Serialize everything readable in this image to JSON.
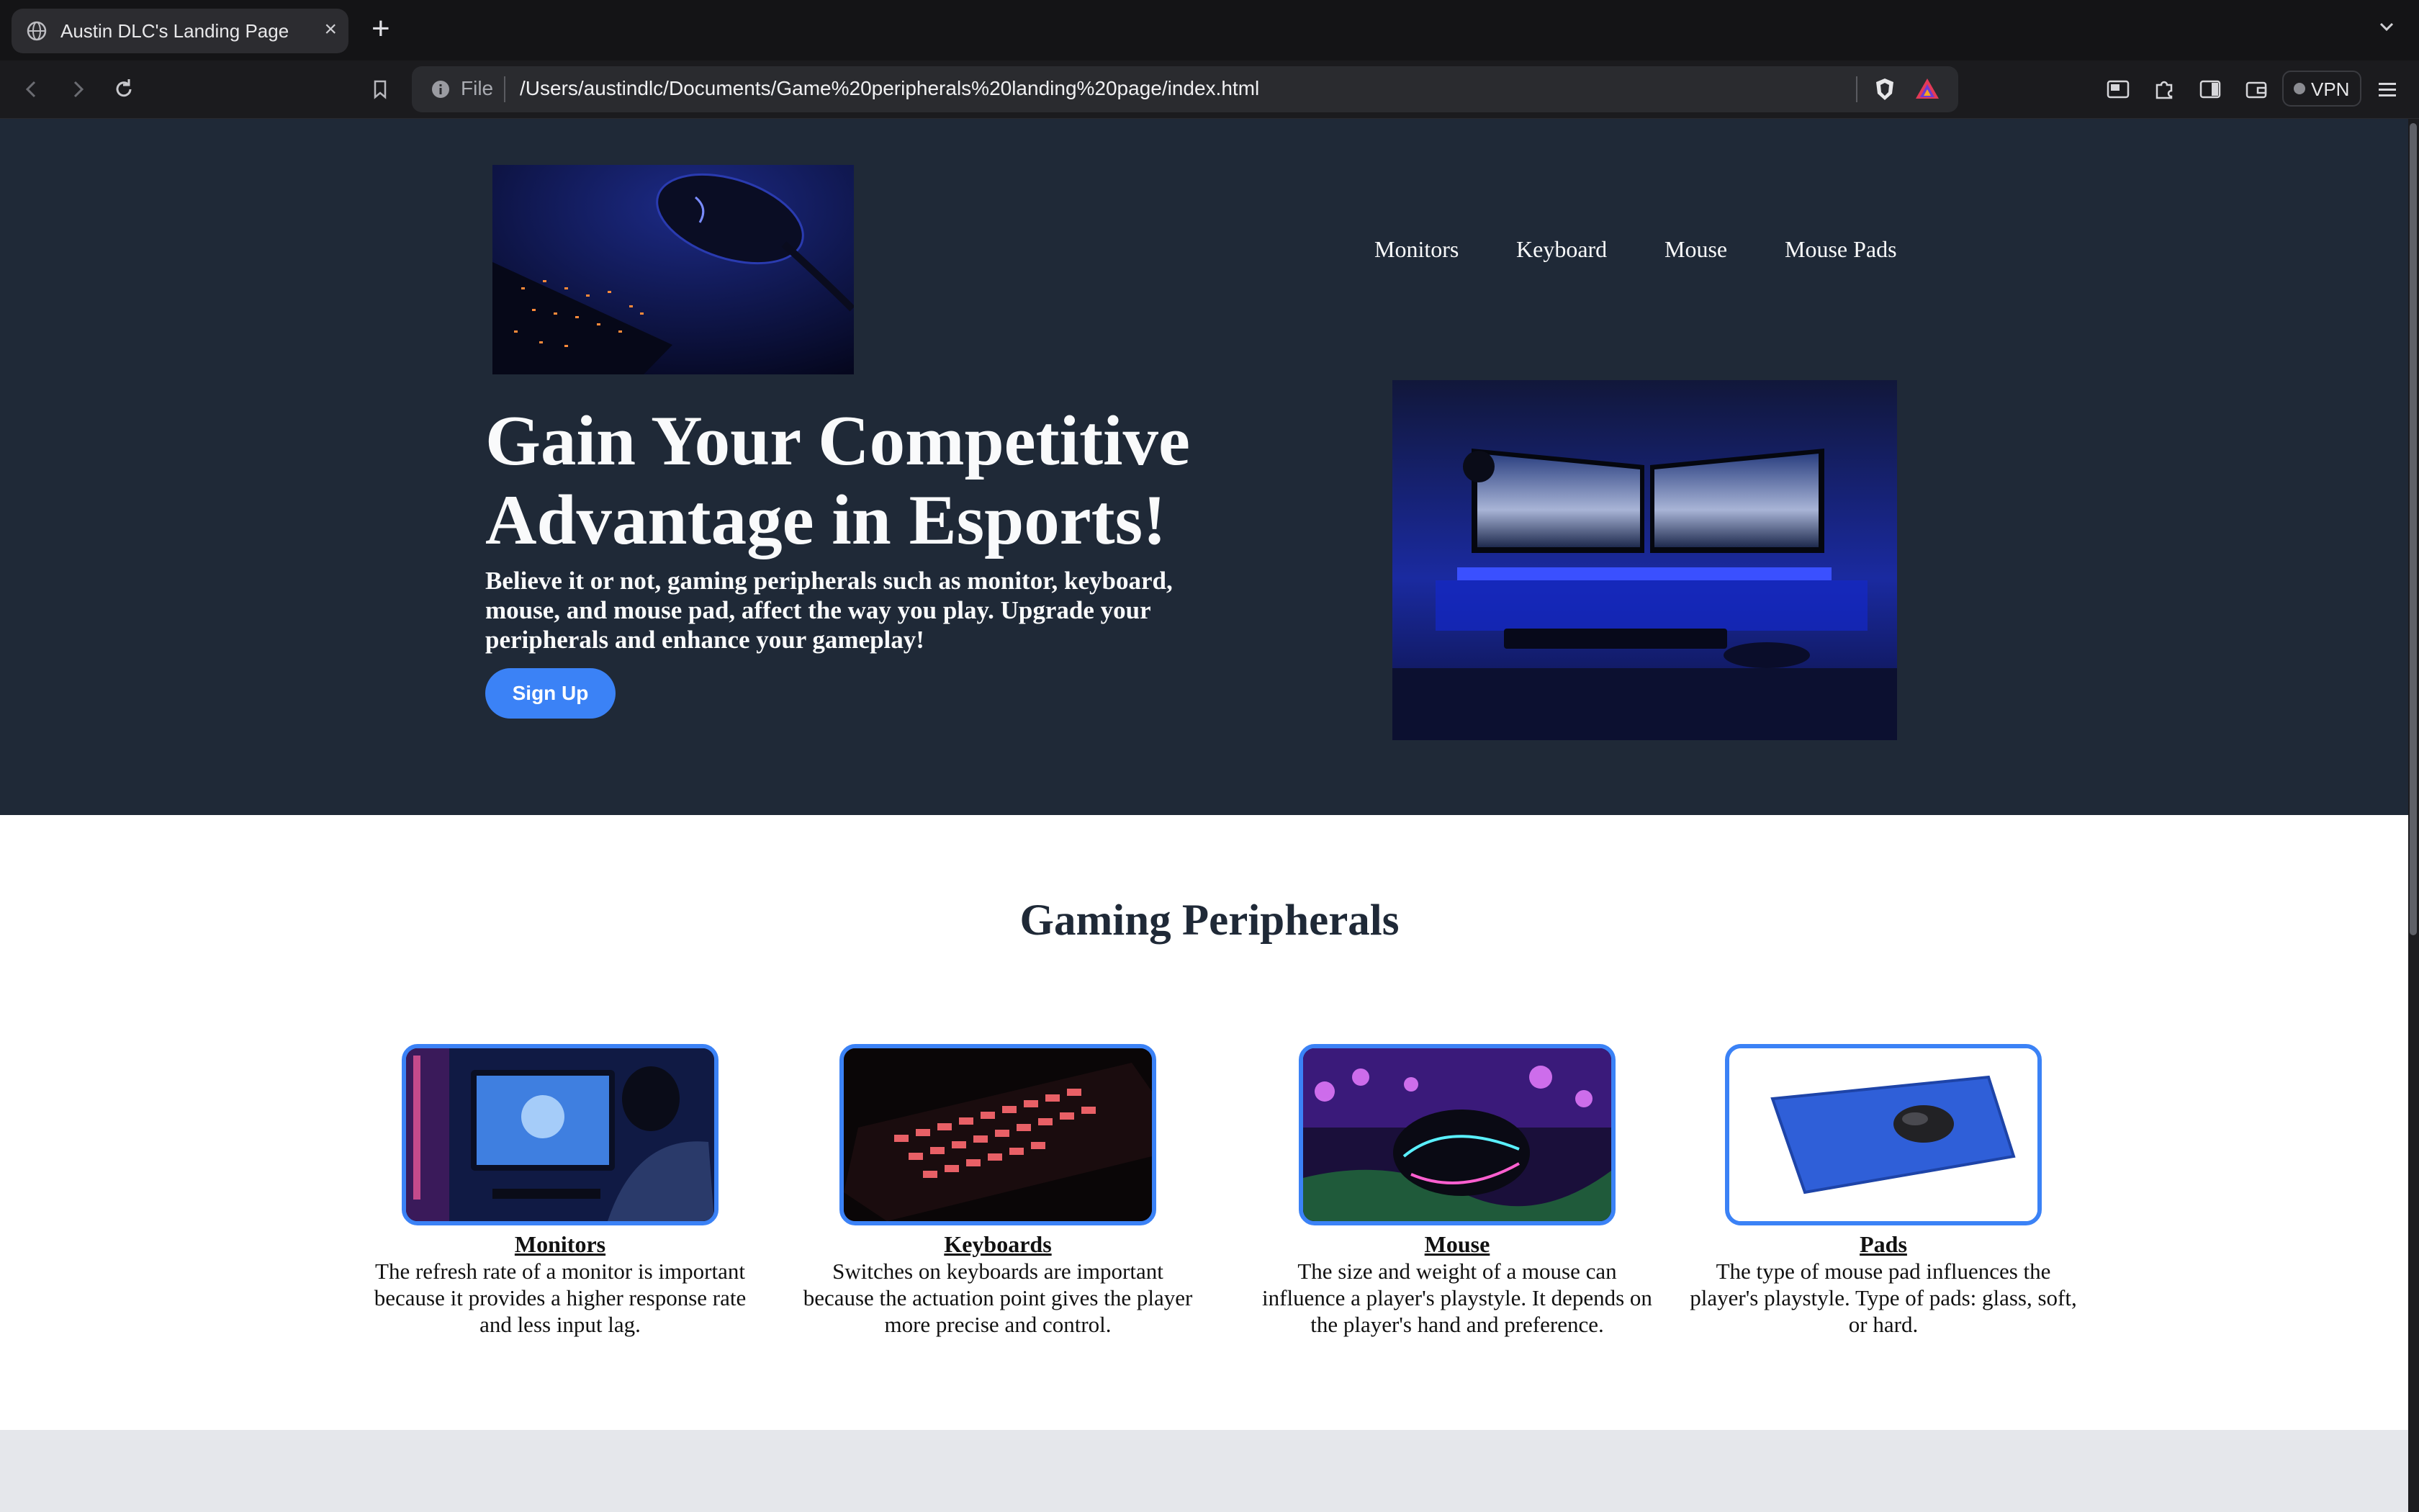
{
  "browser": {
    "tab_title": "Austin DLC's Landing Page",
    "new_tab_symbol": "+",
    "close_symbol": "×",
    "address_scheme": "File",
    "address_url": "/Users/austindlc/Documents/Game%20peripherals%20landing%20page/index.html",
    "vpn_label": "VPN",
    "icons": [
      "globe-icon",
      "back-icon",
      "forward-icon",
      "reload-icon",
      "bookmark-icon",
      "info-icon",
      "brave-shield-icon",
      "brave-rewards-icon",
      "reader-mode-icon",
      "extensions-icon",
      "sidebar-icon",
      "wallet-icon",
      "menu-icon",
      "tab-list-icon"
    ]
  },
  "nav": {
    "items": [
      {
        "label": "Monitors"
      },
      {
        "label": "Keyboard"
      },
      {
        "label": "Mouse"
      },
      {
        "label": "Mouse Pads"
      }
    ]
  },
  "hero": {
    "headline": "Gain Your Competitive Advantage in Esports!",
    "subhead": "Believe it or not, gaming peripherals such as monitor, keyboard, mouse, and mouse pad, affect the way you play. Upgrade your peripherals and enhance your gameplay!",
    "cta_label": "Sign Up"
  },
  "features": {
    "title": "Gaming Peripherals",
    "cards": [
      {
        "title": "Monitors",
        "description": "The refresh rate of a monitor is important because it provides a higher response rate and less input lag."
      },
      {
        "title": "Keyboards",
        "description": "Switches on keyboards are important because the actuation point gives the player more precise and control."
      },
      {
        "title": "Mouse",
        "description": "The size and weight of a mouse can influence a player's playstyle. It depends on the player's hand and preference."
      },
      {
        "title": "Pads",
        "description": "The type of mouse pad influences the player's playstyle. Type of pads: glass, soft, or hard."
      }
    ]
  },
  "colors": {
    "hero_bg": "#1f2937",
    "accent": "#3b82f6",
    "page_bg": "#ffffff",
    "footer_bg": "#e5e7eb",
    "text_light": "#f9fafb"
  }
}
